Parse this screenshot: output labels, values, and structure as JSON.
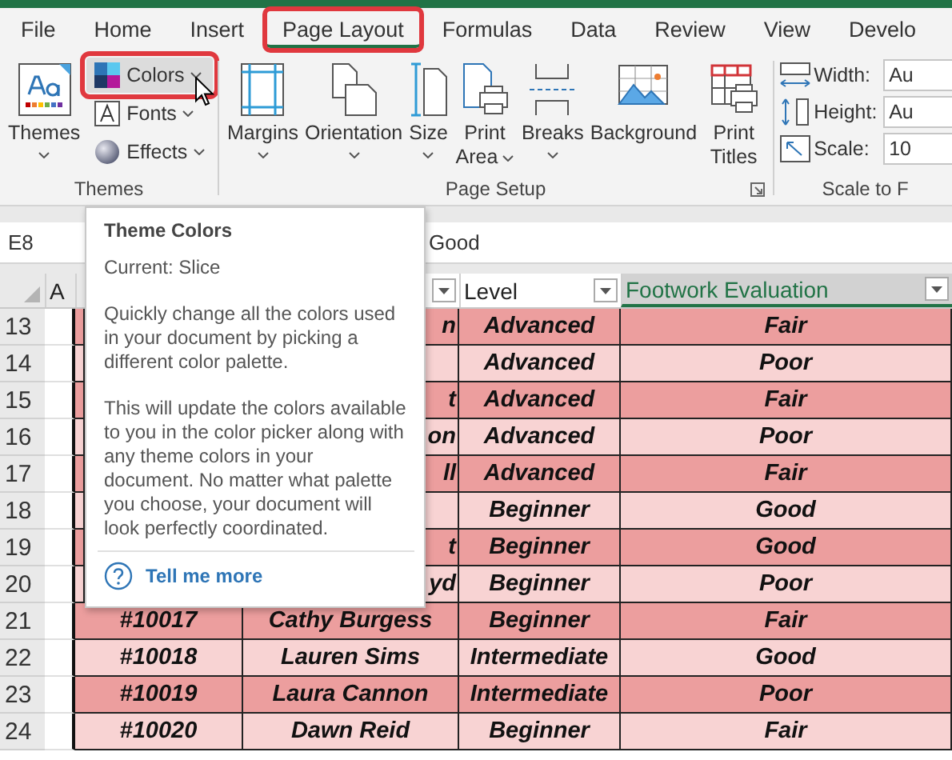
{
  "tabs": [
    {
      "label": "File",
      "selected": false,
      "highlighted": false
    },
    {
      "label": "Home",
      "selected": false,
      "highlighted": false
    },
    {
      "label": "Insert",
      "selected": false,
      "highlighted": false
    },
    {
      "label": "Page Layout",
      "selected": true,
      "highlighted": true
    },
    {
      "label": "Formulas",
      "selected": false,
      "highlighted": false
    },
    {
      "label": "Data",
      "selected": false,
      "highlighted": false
    },
    {
      "label": "Review",
      "selected": false,
      "highlighted": false
    },
    {
      "label": "View",
      "selected": false,
      "highlighted": false
    },
    {
      "label": "Develo",
      "selected": false,
      "highlighted": false
    }
  ],
  "themes_group": {
    "label": "Themes",
    "big_button": {
      "label": "Themes",
      "dropdown": true
    },
    "buttons": [
      {
        "kind": "colors",
        "label": "Colors",
        "highlighted": true,
        "dropdown": true
      },
      {
        "kind": "fonts",
        "label": "Fonts",
        "highlighted": false,
        "dropdown": true
      },
      {
        "kind": "effects",
        "label": "Effects",
        "highlighted": false,
        "dropdown": true
      }
    ]
  },
  "page_setup_group": {
    "label": "Page Setup",
    "buttons": [
      {
        "kind": "margins",
        "label": "Margins",
        "dropdown": true
      },
      {
        "kind": "orientation",
        "label": "Orientation",
        "dropdown": true
      },
      {
        "kind": "size",
        "label": "Size",
        "dropdown": true
      },
      {
        "kind": "printarea",
        "label": "Print Area",
        "dropdown": true
      },
      {
        "kind": "breaks",
        "label": "Breaks",
        "dropdown": true
      },
      {
        "kind": "background",
        "label": "Background",
        "dropdown": false
      },
      {
        "kind": "printtitles",
        "label": "Print Titles",
        "dropdown": false
      }
    ]
  },
  "scale_group": {
    "label": "Scale to F",
    "fields": [
      {
        "kind": "width",
        "label": "Width:",
        "value": "Au"
      },
      {
        "kind": "height",
        "label": "Height:",
        "value": "Au"
      },
      {
        "kind": "scale",
        "label": "Scale:",
        "value": "10"
      }
    ]
  },
  "formula_bar": {
    "name_box": "E8",
    "formula": "Good"
  },
  "columns": [
    {
      "label": "A",
      "filter": false,
      "selected": false
    },
    {
      "filter": false,
      "selected": false
    },
    {
      "filter": true,
      "selected": false
    },
    {
      "label": "Level",
      "filter": true,
      "selected": false
    },
    {
      "label": "Footwork Evaluation",
      "filter": true,
      "selected": true
    }
  ],
  "rows": [
    {
      "number": "13",
      "name": "n",
      "level": "Advanced",
      "evaluation": "Fair"
    },
    {
      "number": "14",
      "level": "Advanced",
      "evaluation": "Poor"
    },
    {
      "number": "15",
      "name": "t",
      "level": "Advanced",
      "evaluation": "Fair"
    },
    {
      "number": "16",
      "name": "on",
      "level": "Advanced",
      "evaluation": "Poor"
    },
    {
      "number": "17",
      "name": "ll",
      "level": "Advanced",
      "evaluation": "Fair"
    },
    {
      "number": "18",
      "level": "Beginner",
      "evaluation": "Good"
    },
    {
      "number": "19",
      "name": "t",
      "level": "Beginner",
      "evaluation": "Good"
    },
    {
      "number": "20",
      "name": "yd",
      "level": "Beginner",
      "evaluation": "Poor"
    },
    {
      "number": "21",
      "id": "#10017",
      "name": "Cathy Burgess",
      "level": "Beginner",
      "evaluation": "Fair"
    },
    {
      "number": "22",
      "id": "#10018",
      "name": "Lauren Sims",
      "level": "Intermediate",
      "evaluation": "Good"
    },
    {
      "number": "23",
      "id": "#10019",
      "name": "Laura Cannon",
      "level": "Intermediate",
      "evaluation": "Poor"
    },
    {
      "number": "24",
      "id": "#10020",
      "name": "Dawn Reid",
      "level": "Beginner",
      "evaluation": "Fair"
    }
  ],
  "tooltip": {
    "title": "Theme Colors",
    "current": "Current: Slice",
    "paragraphs": [
      "Quickly change all the colors used in your document by picking a different color palette.",
      "This will update the colors available to you in the color picker along with any theme colors in your document. No matter what palette you choose, your document will look perfectly coordinated."
    ],
    "link": "Tell me more"
  }
}
